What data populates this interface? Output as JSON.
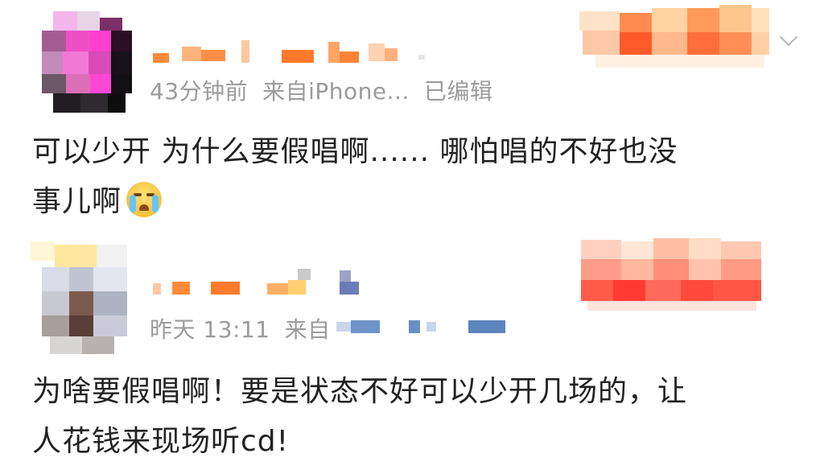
{
  "comments": [
    {
      "meta": {
        "time": "43分钟前",
        "source": "来自iPhone...",
        "edited": "已编辑"
      },
      "text_line1": "可以少开 为什么要假唱啊......  哪怕唱的不好也没",
      "text_line2": "事儿啊",
      "emoji": "crying-face-icon"
    },
    {
      "meta": {
        "time": "昨天 13:11",
        "source": "来自"
      },
      "text_line1": "为啥要假唱啊！要是状态不好可以少开几场的，让",
      "text_line2": "人花钱来现场听cd!"
    }
  ],
  "icons": {
    "expand": "chevron-down-icon"
  },
  "colors": {
    "meta_text": "#9b9b9b",
    "body_text": "#222222",
    "accent_orange": "#f26522"
  }
}
